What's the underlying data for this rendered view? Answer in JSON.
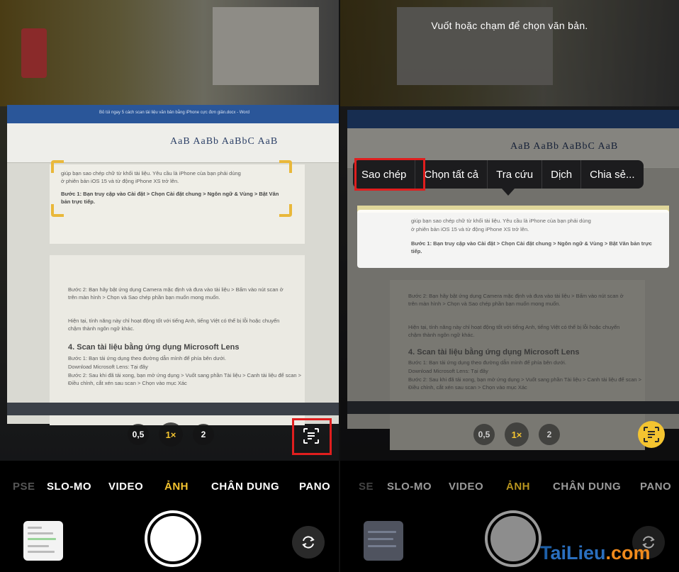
{
  "left": {
    "document": {
      "title_bar": "Bỏ túi ngay 5 cách scan tài liệu văn bản bằng iPhone cực đơn giản.docx - Word",
      "ribbon_styles": "AaB  AaBb  AaBbC  AaB",
      "line1": "giúp bạn sao chép chữ từ khối tài liệu. Yêu cầu là iPhone của bạn phải dùng",
      "line2": "ở phiên bản iOS 15 và từ động iPhone XS trở lên.",
      "step1": "Bước 1: Bạn truy cập vào Cài đặt > Chọn Cài đặt chung > Ngôn ngữ & Vùng > Bật Văn bản trực tiếp.",
      "step2": "Bước 2: Bạn hãy bật ứng dụng Camera mặc định và đưa vào tài liệu > Bấm vào nút scan ở trên màn hình > Chọn và Sao chép phần bạn muốn mong muốn.",
      "note": "Hiện tại, tính năng này chỉ hoạt động tốt với tiếng Anh, tiếng Việt có thể bị lỗi hoặc chuyển chậm thành ngôn ngữ khác.",
      "heading": "4. Scan tài liệu bằng ứng dụng Microsoft Lens",
      "lens1": "Bước 1: Bạn tải ứng dụng theo đường dẫn mình để phía bên dưới.",
      "lens2": "Download Microsoft Lens: Tại đây",
      "lens3": "Bước 2: Sau khi đã tải xong, bạn mở ứng dụng > Vuốt sang phần Tài liệu > Canh tài liệu để scan > Điều chỉnh, cắt xén sau scan > Chọn vào mục Xác"
    },
    "zoom": {
      "z05": "0,5",
      "z1": "1×",
      "z2": "2"
    },
    "modes": {
      "lapse": "PSE",
      "slomo": "SLO-MO",
      "video": "VIDEO",
      "photo": "ẢNH",
      "portrait": "CHÂN DUNG",
      "pano": "PANO"
    }
  },
  "right": {
    "hint": "Vuốt hoặc chạm để chọn văn bản.",
    "menu": {
      "copy": "Sao chép",
      "select_all": "Chọn tất cả",
      "lookup": "Tra cứu",
      "translate": "Dịch",
      "share": "Chia sẻ..."
    },
    "selected": {
      "line1": "giúp bạn sao chép chữ từ khối tài liệu. Yêu cầu là iPhone của bạn phải dùng",
      "line2": "ở phiên bản iOS 15 và từ động iPhone XS trở lên.",
      "step1": "Bước 1: Bạn truy cập vào Cài đặt > Chọn Cài đặt chung > Ngôn ngữ & Vùng > Bật Văn bản trực tiếp."
    },
    "zoom": {
      "z05": "0,5",
      "z1": "1×",
      "z2": "2"
    },
    "modes": {
      "lapse": "SE",
      "slomo": "SLO-MO",
      "video": "VIDEO",
      "photo": "ẢNH",
      "portrait": "CHÂN DUNG",
      "pano": "PANO"
    }
  },
  "watermark": {
    "t": "T",
    "rest": "aiLieu",
    "com": ".com"
  },
  "colors": {
    "accent_yellow": "#f4c430",
    "highlight_red": "#e01e1e",
    "menu_bg": "#1c1c1e"
  },
  "icons": {
    "live_text": "live-text-icon",
    "flip": "camera-flip-icon"
  }
}
